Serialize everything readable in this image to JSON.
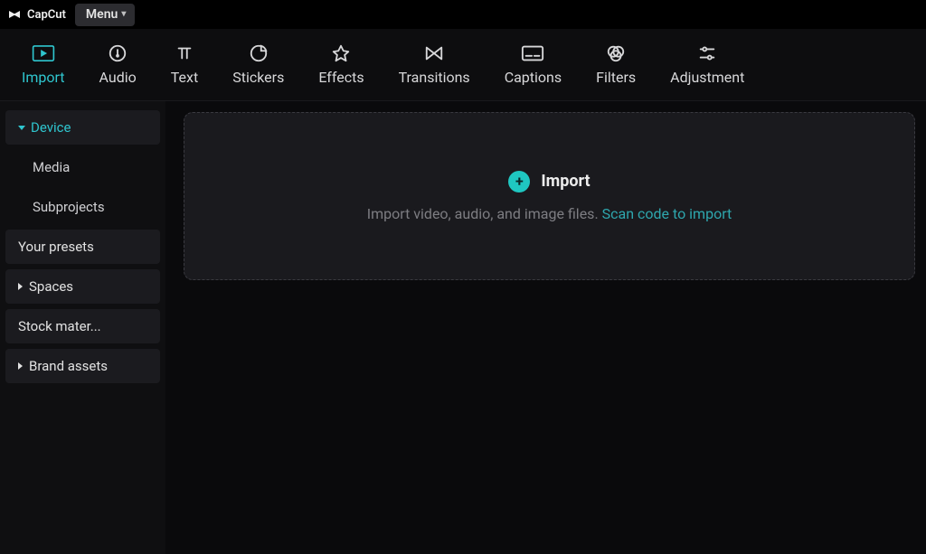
{
  "app": {
    "name": "CapCut",
    "menu_label": "Menu"
  },
  "topnav": {
    "items": [
      {
        "id": "import",
        "label": "Import",
        "active": true
      },
      {
        "id": "audio",
        "label": "Audio",
        "active": false
      },
      {
        "id": "text",
        "label": "Text",
        "active": false
      },
      {
        "id": "stickers",
        "label": "Stickers",
        "active": false
      },
      {
        "id": "effects",
        "label": "Effects",
        "active": false
      },
      {
        "id": "transitions",
        "label": "Transitions",
        "active": false
      },
      {
        "id": "captions",
        "label": "Captions",
        "active": false
      },
      {
        "id": "filters",
        "label": "Filters",
        "active": false
      },
      {
        "id": "adjustment",
        "label": "Adjustment",
        "active": false
      }
    ]
  },
  "sidebar": {
    "items": [
      {
        "id": "device",
        "label": "Device",
        "type": "group",
        "active": true,
        "expanded": true
      },
      {
        "id": "media",
        "label": "Media",
        "type": "sub",
        "active": false
      },
      {
        "id": "subprojects",
        "label": "Subprojects",
        "type": "sub",
        "active": false
      },
      {
        "id": "your-presets",
        "label": "Your presets",
        "type": "item",
        "active": false
      },
      {
        "id": "spaces",
        "label": "Spaces",
        "type": "group",
        "active": false,
        "expanded": false
      },
      {
        "id": "stock",
        "label": "Stock mater...",
        "type": "item",
        "active": false
      },
      {
        "id": "brand-assets",
        "label": "Brand assets",
        "type": "group",
        "active": false,
        "expanded": false
      }
    ]
  },
  "dropzone": {
    "title": "Import",
    "subtitle_prefix": "Import video, audio, and image files. ",
    "subtitle_link": "Scan code to import"
  }
}
